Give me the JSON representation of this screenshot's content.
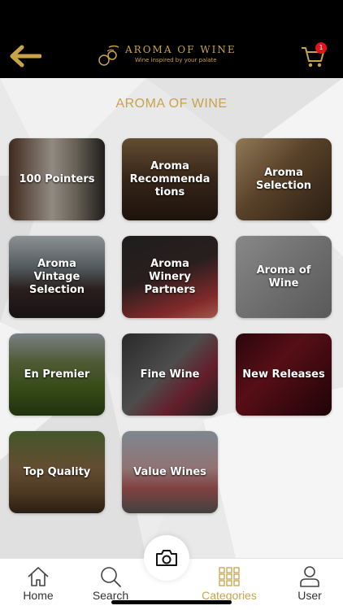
{
  "header": {
    "brand_title": "AROMA OF WINE",
    "brand_tagline": "Wine inspired by your palate",
    "cart_count": "1",
    "accent_color": "#c7a34a",
    "badge_color": "#e0141b"
  },
  "page": {
    "title": "AROMA OF WINE"
  },
  "categories": [
    {
      "label": "100 Pointers"
    },
    {
      "label": "Aroma\nRecommenda\ntions"
    },
    {
      "label": "Aroma\nSelection"
    },
    {
      "label": "Aroma\nVintage\nSelection"
    },
    {
      "label": "Aroma\nWinery\nPartners"
    },
    {
      "label": "Aroma of\nWine"
    },
    {
      "label": "En Premier"
    },
    {
      "label": "Fine Wine"
    },
    {
      "label": "New Releases"
    },
    {
      "label": "Top Quality"
    },
    {
      "label": "Value Wines"
    }
  ],
  "tabbar": {
    "home": "Home",
    "search": "Search",
    "categories": "Categories",
    "user": "User",
    "active_tab": "categories"
  },
  "icons": {
    "back": "arrow-left-icon",
    "cart": "cart-icon",
    "camera": "camera-icon",
    "home": "home-icon",
    "search": "search-icon",
    "categories": "grid-icon",
    "user": "user-icon"
  }
}
